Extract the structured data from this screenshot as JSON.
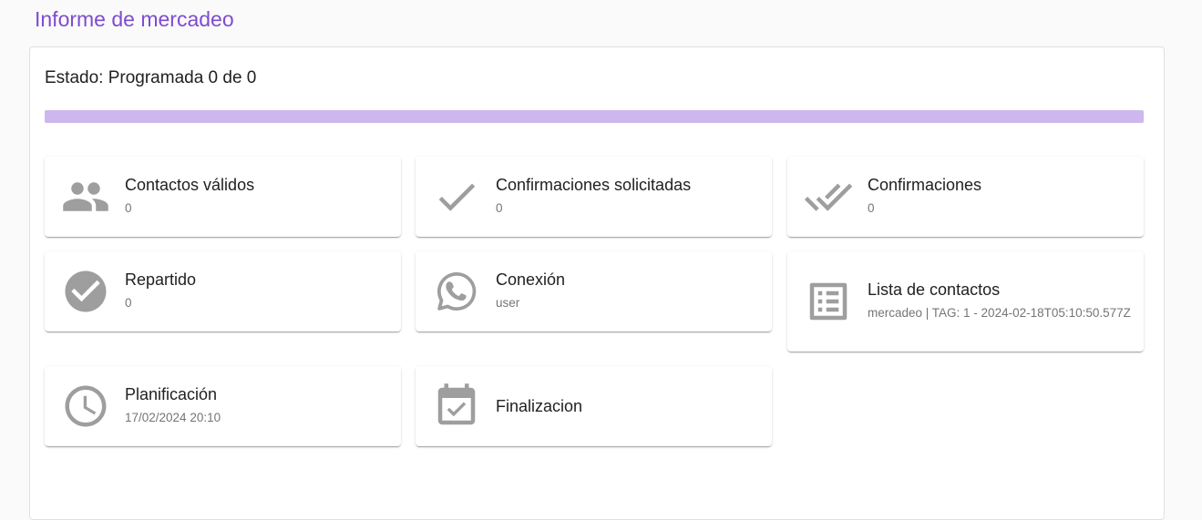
{
  "page": {
    "title": "Informe de mercadeo"
  },
  "status": {
    "text": "Estado: Programada 0 de 0",
    "progress_percent": 0
  },
  "colors": {
    "accent": "#7e4ccf",
    "progress_track": "#cdb7ee",
    "icon": "#9e9e9e"
  },
  "cards": [
    {
      "icon": "people-icon",
      "label": "Contactos válidos",
      "value": "0"
    },
    {
      "icon": "check-icon",
      "label": "Confirmaciones solicitadas",
      "value": "0"
    },
    {
      "icon": "double-check-icon",
      "label": "Confirmaciones",
      "value": "0"
    },
    {
      "icon": "check-circle-icon",
      "label": "Repartido",
      "value": "0"
    },
    {
      "icon": "whatsapp-icon",
      "label": "Conexión",
      "value": "user"
    },
    {
      "icon": "list-alt-icon",
      "label": "Lista de contactos",
      "value": "mercadeo | TAG: 1 - 2024-02-18T05:10:50.577Z"
    },
    {
      "icon": "clock-icon",
      "label": "Planificación",
      "value": "17/02/2024 20:10"
    },
    {
      "icon": "event-available-icon",
      "label": "Finalizacion",
      "value": ""
    }
  ]
}
